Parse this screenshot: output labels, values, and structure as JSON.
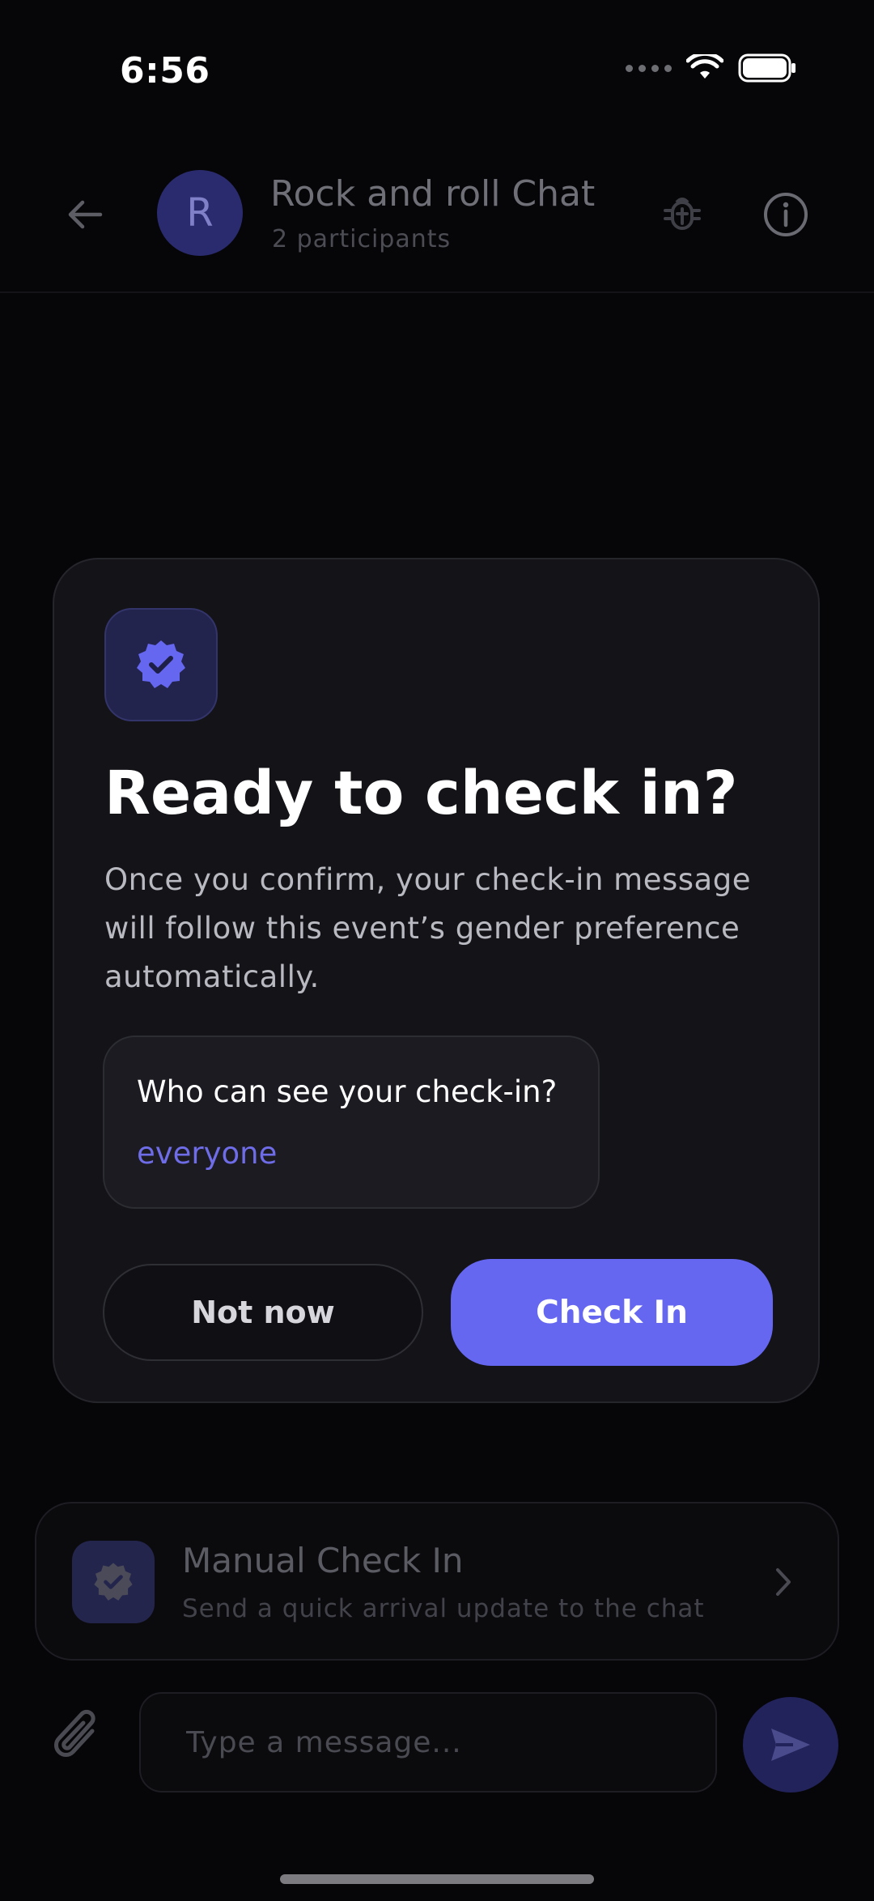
{
  "status_bar": {
    "time": "6:56"
  },
  "header": {
    "avatar_letter": "R",
    "title": "Rock and roll Chat",
    "subtitle": "2 participants"
  },
  "modal": {
    "title": "Ready to check in?",
    "description": "Once you confirm, your check-in message will follow this event’s gender preference automatically.",
    "visibility": {
      "label": "Who can see your check-in?",
      "value": "everyone"
    },
    "secondary_button": "Not now",
    "primary_button": "Check In"
  },
  "manual_checkin": {
    "title": "Manual Check In",
    "subtitle": "Send a quick arrival update to the chat"
  },
  "composer": {
    "placeholder": "Type a message..."
  },
  "colors": {
    "accent": "#6667f1",
    "accent_text": "#6f6ce8",
    "background": "#060608",
    "card": "#131318"
  },
  "icons": [
    "back-arrow-icon",
    "bug-icon",
    "info-icon",
    "verified-badge-icon",
    "chevron-right-icon",
    "paperclip-icon",
    "send-icon",
    "wifi-icon",
    "battery-icon"
  ]
}
